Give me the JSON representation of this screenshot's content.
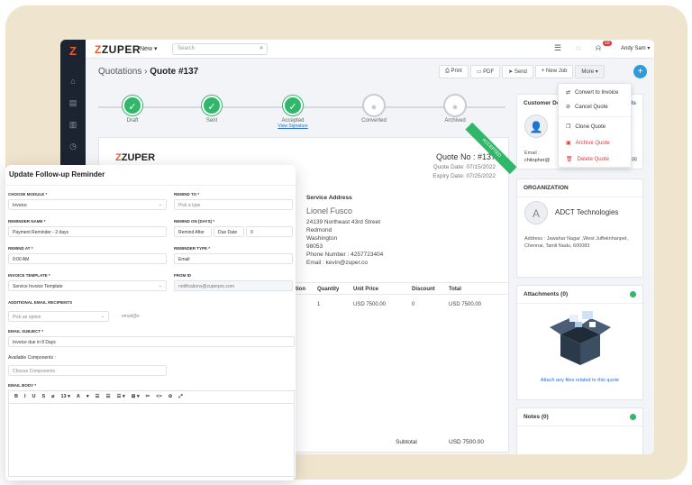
{
  "app": {
    "logo_text": "ZUPER",
    "logo_accent": "Z",
    "new_label": "New",
    "search_placeholder": "Search",
    "notification_count": "10",
    "user_name": "Andy Sam",
    "brand_color": "#f05a28",
    "accent_color": "#30b76a"
  },
  "breadcrumb": {
    "parent": "Quotations",
    "separator": "›",
    "current": "Quote #137"
  },
  "actions": {
    "print": "Print",
    "pdf": "PDF",
    "send": "Send",
    "new_job": "+ New Job",
    "more": "More"
  },
  "steps": [
    {
      "label": "Draft",
      "done": true
    },
    {
      "label": "Sent",
      "done": true
    },
    {
      "label": "Accepted",
      "done": true,
      "sub": "View Signature"
    },
    {
      "label": "Converted",
      "done": false
    },
    {
      "label": "Archived",
      "done": false
    }
  ],
  "more_menu": {
    "convert": "Convert to Invoice",
    "cancel": "Cancel Quote",
    "clone": "Clone Quote",
    "archive": "Archive Quote",
    "delete": "Delete Quote"
  },
  "quote": {
    "brand": "ZUPER",
    "number": "Quote No : #137",
    "date": "Quote Date: 07/15/2022",
    "expiry": "Expiry Date: 07/25/2022",
    "ribbon": "ACCEPTED",
    "service_heading": "Service Address",
    "customer_name": "Lionel Fusco",
    "address": [
      "24139 Northeast 43rd Street",
      "Redmond",
      "Washington",
      "98053",
      "Phone Number : 4257723404",
      "Email : kevin@zuper.co"
    ],
    "columns": [
      "tion",
      "Quantity",
      "Unit Price",
      "Discount",
      "Total"
    ],
    "row": [
      "",
      "1",
      "USD 7500.00",
      "0",
      "USD 7500.00"
    ],
    "subtotal_label": "Subtotal",
    "subtotal_value": "USD 7500.00"
  },
  "sidebar": {
    "customer_title": "Customer Detai",
    "customer_link": "tails",
    "email_label": "Email :",
    "email_value": "chitopher@",
    "org_title": "ORGANIZATION",
    "org_initial": "A",
    "org_name": "ADCT Technologies",
    "org_address": "Address : Jawahar Nagar ,West Juffeknhanpet, Chennai, Tamil Nadu, 600083",
    "attach_title": "Attachments (0)",
    "attach_link": "Attach any files related to this quote",
    "notes_title": "Notes (0)"
  },
  "modal": {
    "title": "Update Follow-up Reminder",
    "choose_module_label": "CHOOSE MODULE *",
    "choose_module_value": "Invoice",
    "remind_to_label": "REMIND TO *",
    "remind_to_ph": "Pick a type",
    "reminder_name_label": "REMINDER NAME *",
    "reminder_name_value": "Payment Reminder - 2 days",
    "remind_on_label": "REMIND ON (DAYS) *",
    "remind_on_a": "Remind After",
    "remind_on_b": "Due Date",
    "remind_on_c": "0",
    "remind_at_label": "REMIND AT *",
    "remind_at_value": "9:00 AM",
    "reminder_type_label": "REMINDER TYPE *",
    "reminder_type_value": "Email",
    "template_label": "INVOICE TEMPLATE *",
    "template_value": "Service Invoice Template",
    "from_label": "FROM ID",
    "from_value": "notifications@zuperpro.com",
    "recipients_label": "ADDITIONAL EMAIL RECIPIENTS",
    "recipients_ph": "Pick an option",
    "recipients_email_ph": "email@e",
    "subject_label": "EMAIL SUBJECT *",
    "subject_value": "Invoice due in 8 Days",
    "components_label": "Available Components :",
    "components_ph": "Choose Components",
    "body_label": "EMAIL BODY *",
    "tools": [
      "B",
      "I",
      "U",
      "S",
      "⌀",
      "13 ▾",
      "A",
      "▾",
      "☰",
      "☰",
      "☰ ▾",
      "⊞ ▾",
      "✂",
      "<>",
      "⊝",
      "⤢"
    ]
  }
}
